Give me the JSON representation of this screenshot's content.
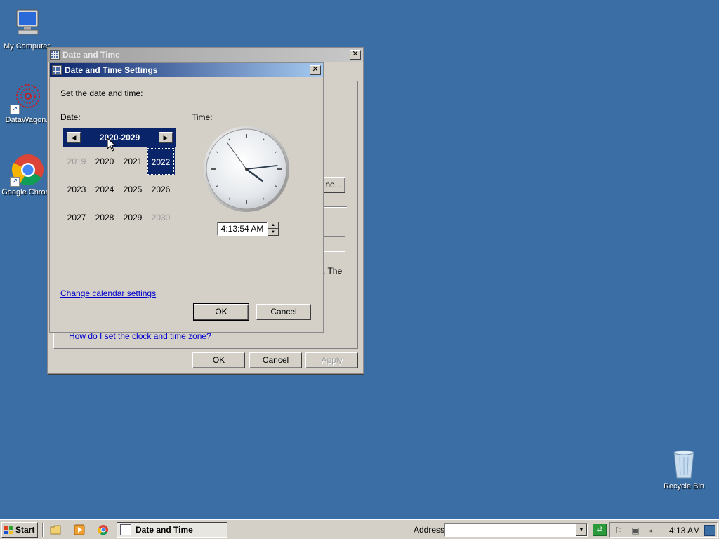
{
  "desktop": {
    "icons": [
      {
        "label": "My Computer"
      },
      {
        "label": "DataWagon."
      },
      {
        "label": "Google Chrom"
      },
      {
        "label": "Recycle Bin"
      }
    ]
  },
  "back_window": {
    "title": "Date and Time",
    "partial_button_label": "ne...",
    "partial_text": ". The",
    "help_link": "How do I set the clock and time zone?",
    "ok_label": "OK",
    "cancel_label": "Cancel",
    "apply_label": "Apply"
  },
  "dialog": {
    "title": "Date and Time Settings",
    "instruction": "Set the date and time:",
    "date_label": "Date:",
    "time_label": "Time:",
    "calendar": {
      "range_title": "2020-2029",
      "years": [
        "2019",
        "2020",
        "2021",
        "2022",
        "2023",
        "2024",
        "2025",
        "2026",
        "2027",
        "2028",
        "2029",
        "2030"
      ],
      "selected": "2022"
    },
    "time_value": "4:13:54 AM",
    "change_calendar_link": "Change calendar settings",
    "ok_label": "OK",
    "cancel_label": "Cancel"
  },
  "taskbar": {
    "start_label": "Start",
    "task_label": "Date and Time",
    "address_label": "Address",
    "address_value": "",
    "clock": "4:13 AM"
  },
  "colors": {
    "desktop": "#3a6ea5",
    "selection": "#0a246a",
    "face": "#d4d0c8"
  }
}
